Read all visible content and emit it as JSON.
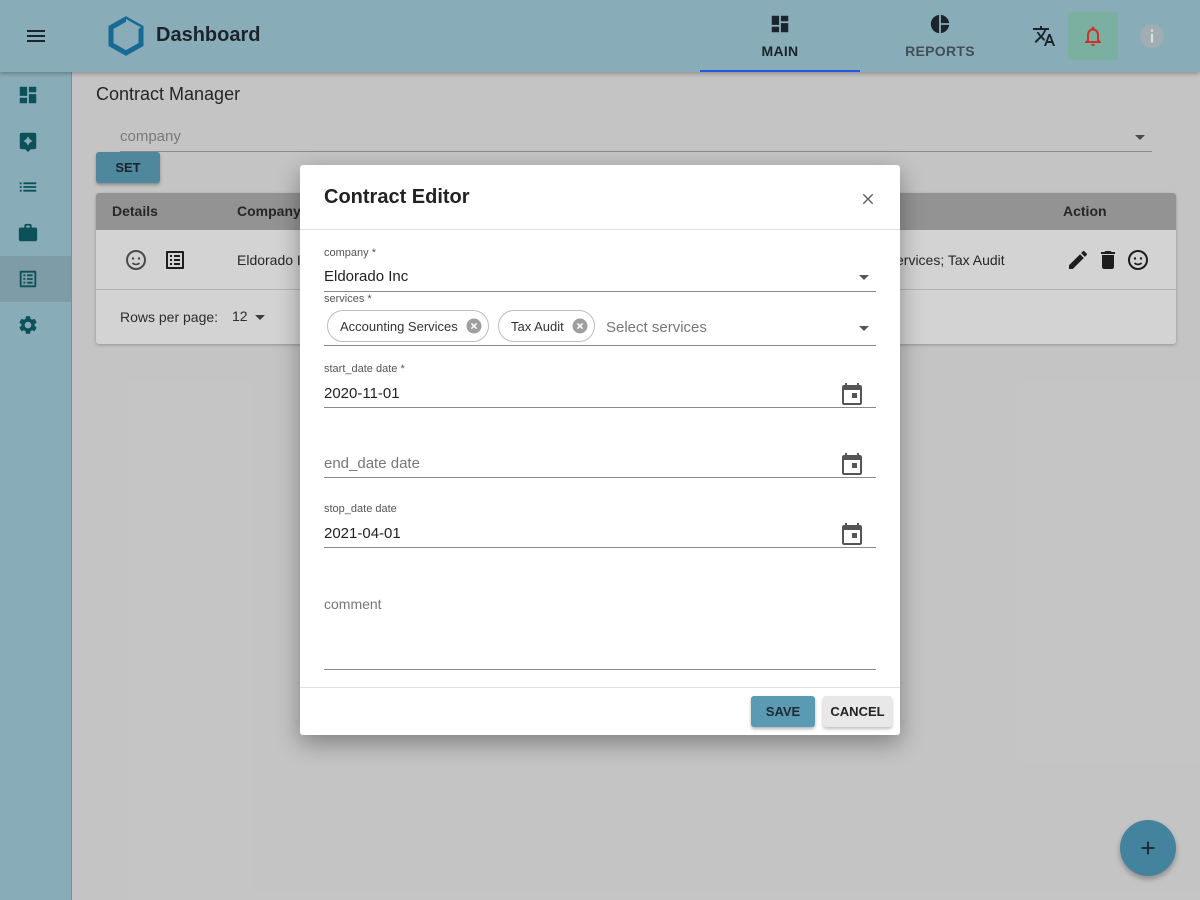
{
  "appbar": {
    "title": "Dashboard",
    "tabs": [
      {
        "label": "MAIN",
        "icon": "dashboard-icon",
        "active": true
      },
      {
        "label": "REPORTS",
        "icon": "pie-chart-icon",
        "active": false
      }
    ]
  },
  "sidebar": {
    "items": [
      {
        "icon": "dashboard-icon",
        "active": false
      },
      {
        "icon": "sparkle-icon",
        "active": false
      },
      {
        "icon": "list-icon",
        "active": false
      },
      {
        "icon": "briefcase-icon",
        "active": false
      },
      {
        "icon": "contract-list-icon",
        "active": true
      },
      {
        "icon": "settings-icon",
        "active": false
      }
    ]
  },
  "main": {
    "page_title": "Contract Manager",
    "company_filter_placeholder": "company",
    "set_label": "SET",
    "table": {
      "headers": {
        "details": "Details",
        "company": "Company",
        "action": "Action"
      },
      "rows": [
        {
          "company": "Eldorado I",
          "services_visible": "ervices; Tax Audit"
        }
      ],
      "rows_per_page_label": "Rows per page:",
      "rows_per_page": "12"
    }
  },
  "dialog": {
    "title": "Contract Editor",
    "company": {
      "label": "company *",
      "value": "Eldorado Inc"
    },
    "services": {
      "label": "services *",
      "chips": [
        "Accounting Services",
        "Tax Audit"
      ],
      "placeholder": "Select services"
    },
    "start_date": {
      "label": "start_date date *",
      "value": "2020-11-01"
    },
    "end_date": {
      "placeholder": "end_date date"
    },
    "stop_date": {
      "label": "stop_date date",
      "value": "2021-04-01"
    },
    "comment": {
      "placeholder": "comment"
    },
    "save_label": "SAVE",
    "cancel_label": "CANCEL"
  },
  "colors": {
    "appbar": "#9cc4d3",
    "primary_button": "#5b9ab3",
    "sidebar_icon": "#0e5c66",
    "tab_indicator": "#2962ff",
    "bell": "#e53935",
    "fab": "#4e96b4"
  }
}
